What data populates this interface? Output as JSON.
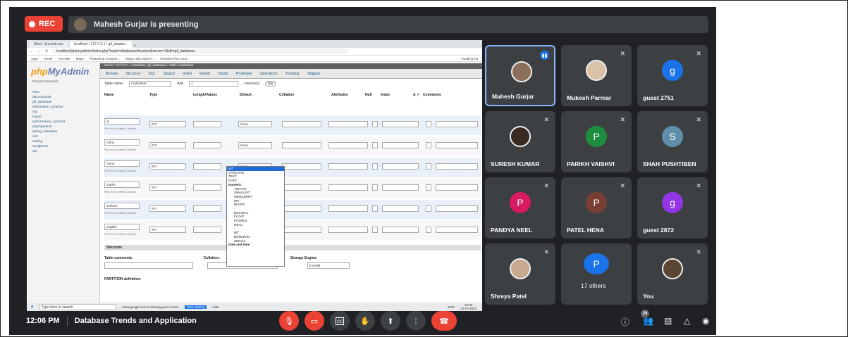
{
  "recording": {
    "label": "REC"
  },
  "presenter": {
    "text": "Mahesh Gurjar is presenting"
  },
  "browser": {
    "tabs": [
      "Meet - kuz-jmk-ruu",
      "localhost / 127.0.0.1 / gtl_databa..."
    ],
    "url": "localhost/phpmyadmin/index.php?route=/database/structure&server=1&db=gtl_database",
    "bookmarks": [
      "Apps",
      "Gmail",
      "YouTube",
      "Maps",
      "Photoshop Scissors...",
      "Maya Help 2020 R...",
      "Premiere Pro tutori..."
    ],
    "reading_list": "Reading list"
  },
  "pma": {
    "logo_a": "php",
    "logo_b": "MyAdmin",
    "recent": "Recent Favorites",
    "crumb": "Server: 127.0.0.1 » Database: gtl_database » Table: marksheet",
    "databases": [
      "New",
      "dbs1414029",
      "gtl_database",
      "information_schema",
      "mg",
      "mysql",
      "performance_schema",
      "phpmyadmin",
      "spring_database",
      "test",
      "testing",
      "wordpress",
      "wp"
    ],
    "tabs": [
      "Browse",
      "Structure",
      "SQL",
      "Search",
      "Insert",
      "Export",
      "Import",
      "Privileges",
      "Operations",
      "Tracking",
      "Triggers"
    ],
    "table_name_label": "Table name:",
    "table_name": "marksheet",
    "add_label": "Add",
    "add_value": "1",
    "columns_label": "column(s)",
    "go": "Go",
    "headers": [
      "Name",
      "Type",
      "Length/Values",
      "Default",
      "Collation",
      "Attributes",
      "Null",
      "Index",
      "A_I",
      "Comments"
    ],
    "rows": [
      {
        "name": "id",
        "type": "INT",
        "default": "None"
      },
      {
        "name": "rollno",
        "type": "INT",
        "default": "None"
      },
      {
        "name": "name",
        "type": "INT",
        "default": "None"
      },
      {
        "name": "maths",
        "type": "INT",
        "default": "None"
      },
      {
        "name": "science",
        "type": "INT",
        "default": "None"
      },
      {
        "name": "english",
        "type": "INT",
        "default": "None"
      }
    ],
    "pick": "Pick from Central Columns",
    "type_options": [
      "INT",
      "VARCHAR",
      "TEXT",
      "DATE",
      "Numeric",
      "TINYINT",
      "SMALLINT",
      "MEDIUMINT",
      "INT",
      "BIGINT",
      "-",
      "DECIMAL",
      "FLOAT",
      "DOUBLE",
      "REAL",
      "-",
      "BIT",
      "BOOLEAN",
      "SERIAL",
      "Date and time"
    ],
    "structure_label": "Structure",
    "table_comments": "Table comments:",
    "collation": "Collation:",
    "storage_engine": "Storage Engine:",
    "engine_value": "InnoDB",
    "partition": "PARTITION definition:"
  },
  "taskbar": {
    "search": "Type here to search",
    "sharing": "meet.google.com is sharing your screen.",
    "stop": "Stop sharing",
    "hide": "Hide",
    "lang": "ENG",
    "time": "12:06",
    "date": "14-10-2021"
  },
  "participants": [
    {
      "name": "Mahesh Gurjar",
      "kind": "photo",
      "initial": "",
      "color": "#8b6f5a",
      "speaking": true
    },
    {
      "name": "Mukesh Parmar",
      "kind": "photo",
      "initial": "",
      "color": "#d9c2a8",
      "speaking": false
    },
    {
      "name": "guest 2751",
      "kind": "letter",
      "initial": "g",
      "color": "#1a73e8",
      "speaking": false
    },
    {
      "name": "SURESH KUMAR",
      "kind": "photo",
      "initial": "",
      "color": "#3a2a22",
      "speaking": false
    },
    {
      "name": "PARIKH VAISHVI",
      "kind": "letter",
      "initial": "P",
      "color": "#1e8e3e",
      "speaking": false
    },
    {
      "name": "SHAH PUSHTIBEN",
      "kind": "letter",
      "initial": "S",
      "color": "#5f8fa8",
      "speaking": false
    },
    {
      "name": "PANDYA NEEL",
      "kind": "letter",
      "initial": "P",
      "color": "#d81b60",
      "speaking": false
    },
    {
      "name": "PATEL HENA",
      "kind": "letter",
      "initial": "P",
      "color": "#7a3f34",
      "speaking": false
    },
    {
      "name": "guest 2872",
      "kind": "letter",
      "initial": "g",
      "color": "#9334e6",
      "speaking": false
    },
    {
      "name": "Shreya Patel",
      "kind": "photo",
      "initial": "",
      "color": "#c9a890",
      "speaking": false
    },
    {
      "name": "17 others",
      "kind": "others",
      "initial": "P",
      "color": "#1a73e8",
      "speaking": false
    },
    {
      "name": "You",
      "kind": "photo",
      "initial": "",
      "color": "#5b4634",
      "speaking": false
    }
  ],
  "meeting": {
    "time": "12:06 PM",
    "title": "Database Trends and Application"
  },
  "people_count": "29"
}
